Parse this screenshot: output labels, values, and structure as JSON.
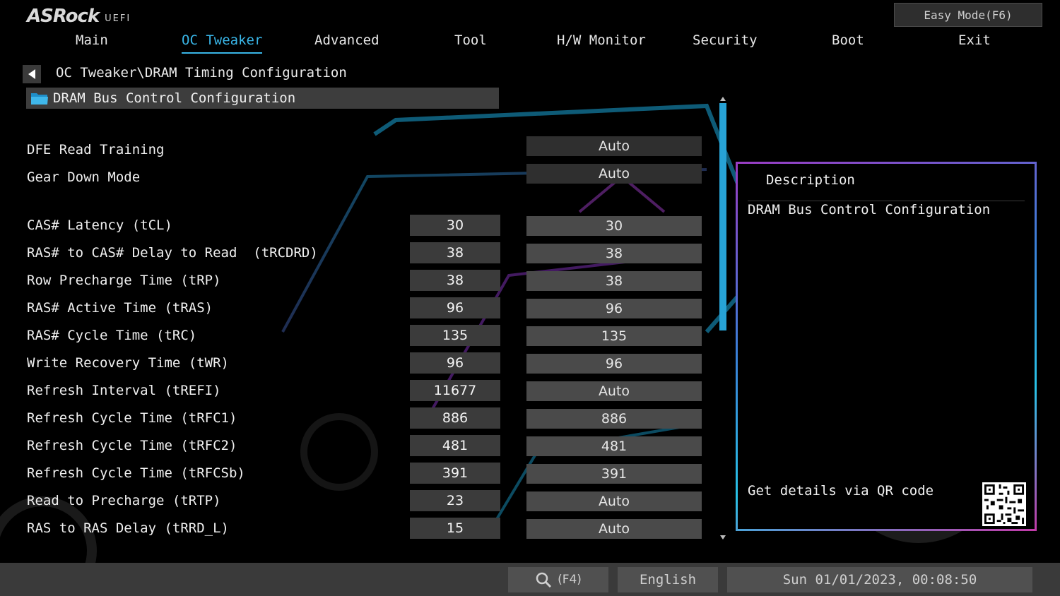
{
  "header": {
    "logo": "ASRock",
    "logo_sub": "UEFI",
    "easy_mode_label": "Easy Mode(F6)"
  },
  "tabs": [
    {
      "label": "Main"
    },
    {
      "label": "OC Tweaker",
      "active": true
    },
    {
      "label": "Advanced"
    },
    {
      "label": "Tool"
    },
    {
      "label": "H/W Monitor"
    },
    {
      "label": "Security"
    },
    {
      "label": "Boot"
    },
    {
      "label": "Exit"
    }
  ],
  "breadcrumb": "OC Tweaker\\DRAM Timing Configuration",
  "submenu": {
    "label": "DRAM Bus Control Configuration",
    "icon": "folder-icon"
  },
  "settings": [
    {
      "label": "DFE Read Training",
      "current": "",
      "value": "Auto"
    },
    {
      "label": "Gear Down Mode",
      "current": "",
      "value": "Auto"
    },
    {
      "label": "CAS# Latency (tCL)",
      "current": "30",
      "value": "30"
    },
    {
      "label": "RAS# to CAS# Delay to Read  (tRCDRD)",
      "current": "38",
      "value": "38"
    },
    {
      "label": "Row Precharge Time (tRP)",
      "current": "38",
      "value": "38"
    },
    {
      "label": "RAS# Active Time (tRAS)",
      "current": "96",
      "value": "96"
    },
    {
      "label": "RAS# Cycle Time (tRC)",
      "current": "135",
      "value": "135"
    },
    {
      "label": "Write Recovery Time (tWR)",
      "current": "96",
      "value": "96"
    },
    {
      "label": "Refresh Interval (tREFI)",
      "current": "11677",
      "value": "Auto"
    },
    {
      "label": "Refresh Cycle Time (tRFC1)",
      "current": "886",
      "value": "886"
    },
    {
      "label": "Refresh Cycle Time (tRFC2)",
      "current": "481",
      "value": "481"
    },
    {
      "label": "Refresh Cycle Time (tRFCSb)",
      "current": "391",
      "value": "391"
    },
    {
      "label": "Read to Precharge (tRTP)",
      "current": "23",
      "value": "Auto"
    },
    {
      "label": "RAS to RAS Delay (tRRD_L)",
      "current": "15",
      "value": "Auto"
    }
  ],
  "description": {
    "title": "Description",
    "text": "DRAM Bus Control Configuration",
    "qr_label": "Get details via QR code"
  },
  "footer": {
    "search_key": "(F4)",
    "language": "English",
    "datetime": "Sun 01/01/2023, 00:08:50"
  },
  "colors": {
    "accent": "#39b6e8",
    "scrollbar": "#27a3d6"
  }
}
